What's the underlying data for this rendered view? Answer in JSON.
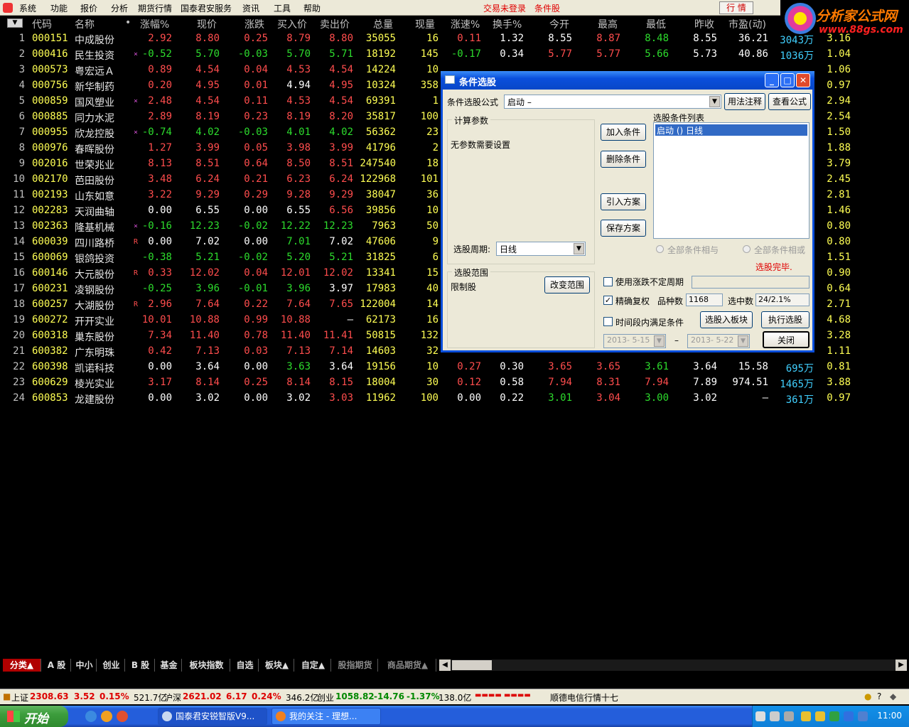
{
  "menu": {
    "items": [
      "系统",
      "功能",
      "报价",
      "分析",
      "期货行情",
      "国泰君安服务",
      "资讯",
      "工具",
      "帮助"
    ],
    "trade_status": "交易未登录",
    "condition_stock": "条件股",
    "quote_button": "行 情"
  },
  "logo": {
    "title": "分析家公式网",
    "url": "www.88gs.com"
  },
  "table": {
    "columns": [
      "代码",
      "名称",
      "•",
      "涨幅%",
      "现价",
      "涨跌",
      "买入价",
      "卖出价",
      "总量",
      "现量",
      "涨速%",
      "换手%",
      "今开",
      "最高",
      "最低",
      "昨收",
      "市盈(动)"
    ],
    "rows": [
      {
        "idx": "1",
        "code": "000151",
        "name": "中成股份",
        "flag": "",
        "chg_pct": "2.92",
        "price": "8.80",
        "chg": "0.25",
        "bid": "8.79",
        "ask": "8.80",
        "vol": "35055",
        "cur": "16",
        "spd": "0.11",
        "turn": "1.32",
        "open": "8.55",
        "high": "8.87",
        "low": "8.48",
        "prev": "8.55",
        "pe": "36.21",
        "amt": "3043万",
        "last": "3.16"
      },
      {
        "idx": "2",
        "code": "000416",
        "name": "民生投资",
        "flag": "×",
        "chg_pct": "-0.52",
        "price": "5.70",
        "chg": "-0.03",
        "bid": "5.70",
        "ask": "5.71",
        "vol": "18192",
        "cur": "145",
        "spd": "-0.17",
        "turn": "0.34",
        "open": "5.77",
        "high": "5.77",
        "low": "5.66",
        "prev": "5.73",
        "pe": "40.86",
        "amt": "1036万",
        "last": "1.04"
      },
      {
        "idx": "3",
        "code": "000573",
        "name": "粤宏远Ａ",
        "flag": "",
        "chg_pct": "0.89",
        "price": "4.54",
        "chg": "0.04",
        "bid": "4.53",
        "ask": "4.54",
        "vol": "14224",
        "cur": "10",
        "spd": "",
        "turn": "",
        "open": "",
        "high": "",
        "low": "",
        "prev": "",
        "pe": "",
        "amt": "",
        "last": "1.06"
      },
      {
        "idx": "4",
        "code": "000756",
        "name": "新华制药",
        "flag": "",
        "chg_pct": "0.20",
        "price": "4.95",
        "chg": "0.01",
        "bid": "4.94",
        "ask": "4.95",
        "vol": "10324",
        "cur": "358",
        "spd": "",
        "turn": "",
        "open": "",
        "high": "",
        "low": "",
        "prev": "",
        "pe": "",
        "amt": "",
        "last": "0.97"
      },
      {
        "idx": "5",
        "code": "000859",
        "name": "国风塑业",
        "flag": "×",
        "chg_pct": "2.48",
        "price": "4.54",
        "chg": "0.11",
        "bid": "4.53",
        "ask": "4.54",
        "vol": "69391",
        "cur": "1",
        "spd": "",
        "turn": "",
        "open": "",
        "high": "",
        "low": "",
        "prev": "",
        "pe": "",
        "amt": "",
        "last": "2.94"
      },
      {
        "idx": "6",
        "code": "000885",
        "name": "同力水泥",
        "flag": "",
        "chg_pct": "2.89",
        "price": "8.19",
        "chg": "0.23",
        "bid": "8.19",
        "ask": "8.20",
        "vol": "35817",
        "cur": "100",
        "spd": "",
        "turn": "",
        "open": "",
        "high": "",
        "low": "",
        "prev": "",
        "pe": "",
        "amt": "",
        "last": "2.54"
      },
      {
        "idx": "7",
        "code": "000955",
        "name": "欣龙控股",
        "flag": "×",
        "chg_pct": "-0.74",
        "price": "4.02",
        "chg": "-0.03",
        "bid": "4.01",
        "ask": "4.02",
        "vol": "56362",
        "cur": "23",
        "spd": "",
        "turn": "",
        "open": "",
        "high": "",
        "low": "",
        "prev": "",
        "pe": "",
        "amt": "",
        "last": "1.50"
      },
      {
        "idx": "8",
        "code": "000976",
        "name": "春晖股份",
        "flag": "",
        "chg_pct": "1.27",
        "price": "3.99",
        "chg": "0.05",
        "bid": "3.98",
        "ask": "3.99",
        "vol": "41796",
        "cur": "2",
        "spd": "",
        "turn": "",
        "open": "",
        "high": "",
        "low": "",
        "prev": "",
        "pe": "",
        "amt": "",
        "last": "1.88"
      },
      {
        "idx": "9",
        "code": "002016",
        "name": "世荣兆业",
        "flag": "",
        "chg_pct": "8.13",
        "price": "8.51",
        "chg": "0.64",
        "bid": "8.50",
        "ask": "8.51",
        "vol": "247540",
        "cur": "18",
        "spd": "",
        "turn": "",
        "open": "",
        "high": "",
        "low": "",
        "prev": "",
        "pe": "",
        "amt": "",
        "last": "3.79"
      },
      {
        "idx": "10",
        "code": "002170",
        "name": "芭田股份",
        "flag": "",
        "chg_pct": "3.48",
        "price": "6.24",
        "chg": "0.21",
        "bid": "6.23",
        "ask": "6.24",
        "vol": "122968",
        "cur": "101",
        "spd": "",
        "turn": "",
        "open": "",
        "high": "",
        "low": "",
        "prev": "",
        "pe": "",
        "amt": "",
        "last": "2.45"
      },
      {
        "idx": "11",
        "code": "002193",
        "name": "山东如意",
        "flag": "",
        "chg_pct": "3.22",
        "price": "9.29",
        "chg": "0.29",
        "bid": "9.28",
        "ask": "9.29",
        "vol": "38047",
        "cur": "36",
        "spd": "",
        "turn": "",
        "open": "",
        "high": "",
        "low": "",
        "prev": "",
        "pe": "",
        "amt": "",
        "last": "2.81"
      },
      {
        "idx": "12",
        "code": "002283",
        "name": "天润曲轴",
        "flag": "",
        "chg_pct": "0.00",
        "price": "6.55",
        "chg": "0.00",
        "bid": "6.55",
        "ask": "6.56",
        "vol": "39856",
        "cur": "10",
        "spd": "",
        "turn": "",
        "open": "",
        "high": "",
        "low": "",
        "prev": "",
        "pe": "",
        "amt": "",
        "last": "1.46"
      },
      {
        "idx": "13",
        "code": "002363",
        "name": "隆基机械",
        "flag": "×",
        "chg_pct": "-0.16",
        "price": "12.23",
        "chg": "-0.02",
        "bid": "12.22",
        "ask": "12.23",
        "vol": "7963",
        "cur": "50",
        "spd": "",
        "turn": "",
        "open": "",
        "high": "",
        "low": "",
        "prev": "",
        "pe": "",
        "amt": "",
        "last": "0.80"
      },
      {
        "idx": "14",
        "code": "600039",
        "name": "四川路桥",
        "flag": "R",
        "chg_pct": "0.00",
        "price": "7.02",
        "chg": "0.00",
        "bid": "7.01",
        "ask": "7.02",
        "vol": "47606",
        "cur": "9",
        "spd": "",
        "turn": "",
        "open": "",
        "high": "",
        "low": "",
        "prev": "",
        "pe": "",
        "amt": "",
        "last": "0.80"
      },
      {
        "idx": "15",
        "code": "600069",
        "name": "银鸽投资",
        "flag": "",
        "chg_pct": "-0.38",
        "price": "5.21",
        "chg": "-0.02",
        "bid": "5.20",
        "ask": "5.21",
        "vol": "31825",
        "cur": "6",
        "spd": "",
        "turn": "",
        "open": "",
        "high": "",
        "low": "",
        "prev": "",
        "pe": "",
        "amt": "",
        "last": "1.51"
      },
      {
        "idx": "16",
        "code": "600146",
        "name": "大元股份",
        "flag": "R",
        "chg_pct": "0.33",
        "price": "12.02",
        "chg": "0.04",
        "bid": "12.01",
        "ask": "12.02",
        "vol": "13341",
        "cur": "15",
        "spd": "",
        "turn": "",
        "open": "",
        "high": "",
        "low": "",
        "prev": "",
        "pe": "",
        "amt": "",
        "last": "0.90"
      },
      {
        "idx": "17",
        "code": "600231",
        "name": "凌钢股份",
        "flag": "",
        "chg_pct": "-0.25",
        "price": "3.96",
        "chg": "-0.01",
        "bid": "3.96",
        "ask": "3.97",
        "vol": "17983",
        "cur": "40",
        "spd": "",
        "turn": "",
        "open": "",
        "high": "",
        "low": "",
        "prev": "",
        "pe": "",
        "amt": "",
        "last": "0.64"
      },
      {
        "idx": "18",
        "code": "600257",
        "name": "大湖股份",
        "flag": "R",
        "chg_pct": "2.96",
        "price": "7.64",
        "chg": "0.22",
        "bid": "7.64",
        "ask": "7.65",
        "vol": "122004",
        "cur": "14",
        "spd": "",
        "turn": "",
        "open": "",
        "high": "",
        "low": "",
        "prev": "",
        "pe": "",
        "amt": "",
        "last": "2.71"
      },
      {
        "idx": "19",
        "code": "600272",
        "name": "开开实业",
        "flag": "",
        "chg_pct": "10.01",
        "price": "10.88",
        "chg": "0.99",
        "bid": "10.88",
        "ask": "—",
        "vol": "62173",
        "cur": "16",
        "spd": "",
        "turn": "",
        "open": "",
        "high": "",
        "low": "",
        "prev": "",
        "pe": "",
        "amt": "",
        "last": "4.68"
      },
      {
        "idx": "20",
        "code": "600318",
        "name": "巢东股份",
        "flag": "",
        "chg_pct": "7.34",
        "price": "11.40",
        "chg": "0.78",
        "bid": "11.40",
        "ask": "11.41",
        "vol": "50815",
        "cur": "132",
        "spd": "",
        "turn": "",
        "open": "",
        "high": "",
        "low": "",
        "prev": "",
        "pe": "",
        "amt": "",
        "last": "3.28"
      },
      {
        "idx": "21",
        "code": "600382",
        "name": "广东明珠",
        "flag": "",
        "chg_pct": "0.42",
        "price": "7.13",
        "chg": "0.03",
        "bid": "7.13",
        "ask": "7.14",
        "vol": "14603",
        "cur": "32",
        "spd": "",
        "turn": "",
        "open": "",
        "high": "",
        "low": "",
        "prev": "",
        "pe": "",
        "amt": "",
        "last": "1.11"
      },
      {
        "idx": "22",
        "code": "600398",
        "name": "凯诺科技",
        "flag": "",
        "chg_pct": "0.00",
        "price": "3.64",
        "chg": "0.00",
        "bid": "3.63",
        "ask": "3.64",
        "vol": "19156",
        "cur": "10",
        "spd": "0.27",
        "turn": "0.30",
        "open": "3.65",
        "high": "3.65",
        "low": "3.61",
        "prev": "3.64",
        "pe": "15.58",
        "amt": "695万",
        "last": "0.81"
      },
      {
        "idx": "23",
        "code": "600629",
        "name": "棱光实业",
        "flag": "",
        "chg_pct": "3.17",
        "price": "8.14",
        "chg": "0.25",
        "bid": "8.14",
        "ask": "8.15",
        "vol": "18004",
        "cur": "30",
        "spd": "0.12",
        "turn": "0.58",
        "open": "7.94",
        "high": "8.31",
        "low": "7.94",
        "prev": "7.89",
        "pe": "974.51",
        "amt": "1465万",
        "last": "3.88"
      },
      {
        "idx": "24",
        "code": "600853",
        "name": "龙建股份",
        "flag": "",
        "chg_pct": "0.00",
        "price": "3.02",
        "chg": "0.00",
        "bid": "3.02",
        "ask": "3.03",
        "vol": "11962",
        "cur": "100",
        "spd": "0.00",
        "turn": "0.22",
        "open": "3.01",
        "high": "3.04",
        "low": "3.00",
        "prev": "3.02",
        "pe": "—",
        "amt": "361万",
        "last": "0.97"
      }
    ]
  },
  "dialog": {
    "title": "条件选股",
    "formula_label": "条件选股公式",
    "formula_value": "启动          –",
    "usage_button": "用法注释",
    "view_formula_button": "查看公式",
    "calc_params_title": "计算参数",
    "no_params_text": "无参数需要设置",
    "period_label": "选股周期:",
    "period_value": "日线",
    "add_condition": "加入条件",
    "delete_condition": "删除条件",
    "import_plan": "引入方案",
    "save_plan": "保存方案",
    "condition_list_label": "选股条件列表",
    "condition_item": "启动  ()  日线",
    "radio_and": "全部条件相与",
    "radio_or": "全部条件相或",
    "done_text": "选股完毕.",
    "range_title": "选股范围",
    "range_value": "限制股",
    "change_range": "改变范围",
    "use_uncertain_period": "使用涨跌不定周期",
    "exact_reweight": "精确复权",
    "variety_count_label": "品种数",
    "variety_count": "1168",
    "selected_count_label": "选中数",
    "selected_count": "24/2.1%",
    "time_range_label": "时间段内满足条件",
    "to_block_button": "选股入板块",
    "execute_button": "执行选股",
    "date_from": "2013- 5-15",
    "date_to": "2013- 5-22",
    "date_sep": "–",
    "close_button": "关闭"
  },
  "tabs": [
    {
      "label": "分类▲"
    },
    {
      "label": "A 股"
    },
    {
      "label": "中小"
    },
    {
      "label": "创业"
    },
    {
      "label": "B 股"
    },
    {
      "label": "基金"
    },
    {
      "label": "板块指数"
    },
    {
      "label": "自选"
    },
    {
      "label": "板块▲"
    },
    {
      "label": "自定▲"
    },
    {
      "label": "股指期货"
    },
    {
      "label": "商品期货▲"
    }
  ],
  "status": {
    "sh_label": "上证",
    "sh_value": "2308.63",
    "sh_chg": "3.52",
    "sh_pct": "0.15%",
    "sh_amt": "521.7亿",
    "sz_label": "沪深",
    "sz_value": "2621.02",
    "sz_chg": "6.17",
    "sz_pct": "0.24%",
    "sz_amt": "346.2亿",
    "cy_label": "创业",
    "cy_value": "1058.82",
    "cy_chg": "-14.76",
    "cy_pct": "-1.37%",
    "cy_amt": "138.0亿",
    "server": "顺德电信行情十七"
  },
  "taskbar": {
    "start": "开始",
    "window1": "国泰君安锐智版V9...",
    "window2": "我的关注 - 理想...",
    "clock": "11:00"
  }
}
